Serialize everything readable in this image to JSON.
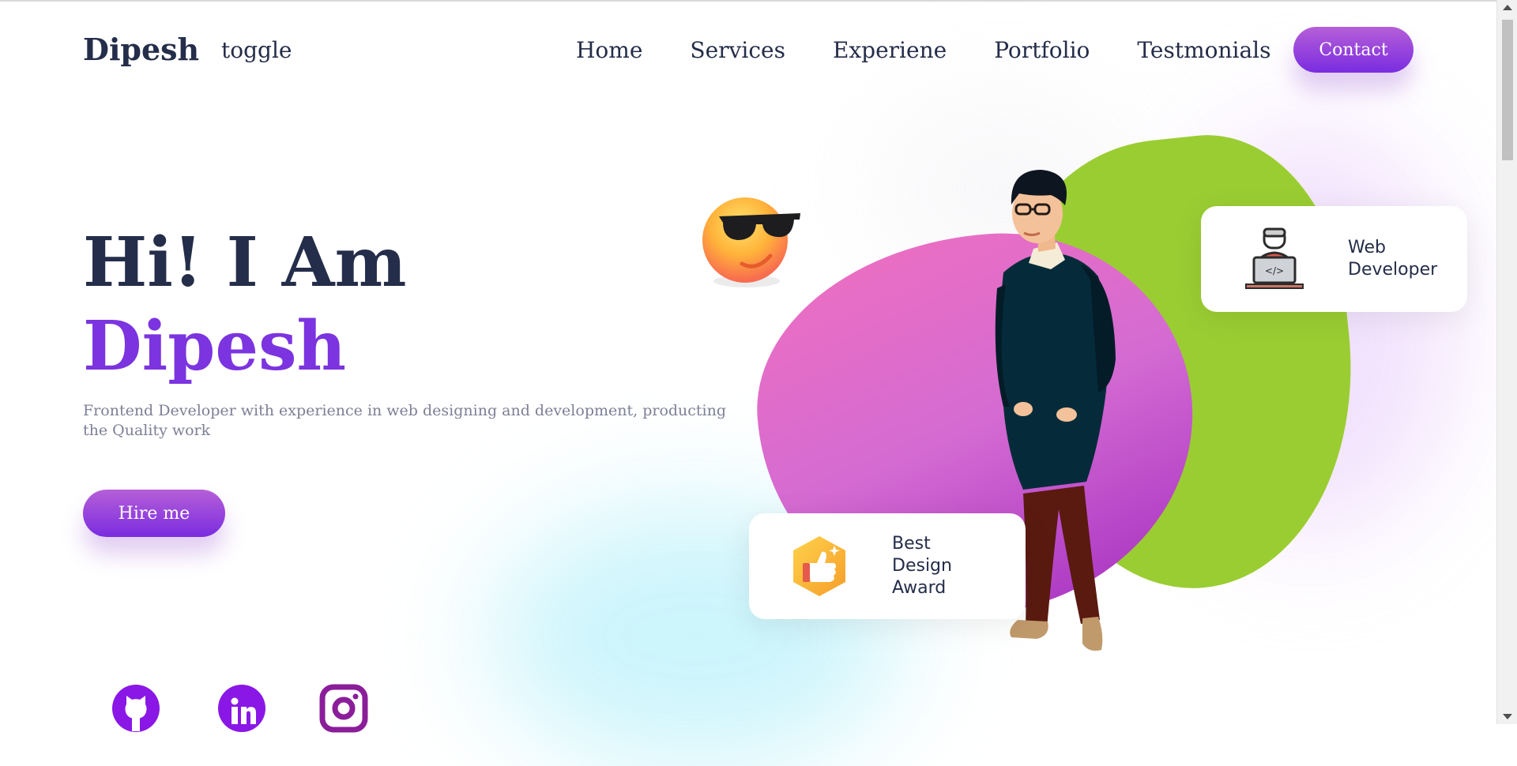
{
  "nav": {
    "logo": "Dipesh",
    "toggle": "toggle",
    "menu": [
      "Home",
      "Services",
      "Experiene",
      "Portfolio",
      "Testmonials"
    ],
    "contact_label": "Contact"
  },
  "hero": {
    "greeting": "Hi! I Am",
    "name": "Dipesh",
    "description": "Frontend Developer with experience in web designing and development, producting the Quality work",
    "hire_label": "Hire me"
  },
  "cards": {
    "web_developer": "Web Developer",
    "best_design_award": "Best Design Award"
  },
  "social": [
    "github-icon",
    "linkedin-icon",
    "instagram-icon"
  ],
  "colors": {
    "primary_text": "#242d49",
    "accent_purple": "#7b34df",
    "button_gradient_start": "#b55fd8",
    "button_gradient_end": "#7a2ce0",
    "green_blob": "#9acd32",
    "pink_blob": "#f06fbf"
  }
}
